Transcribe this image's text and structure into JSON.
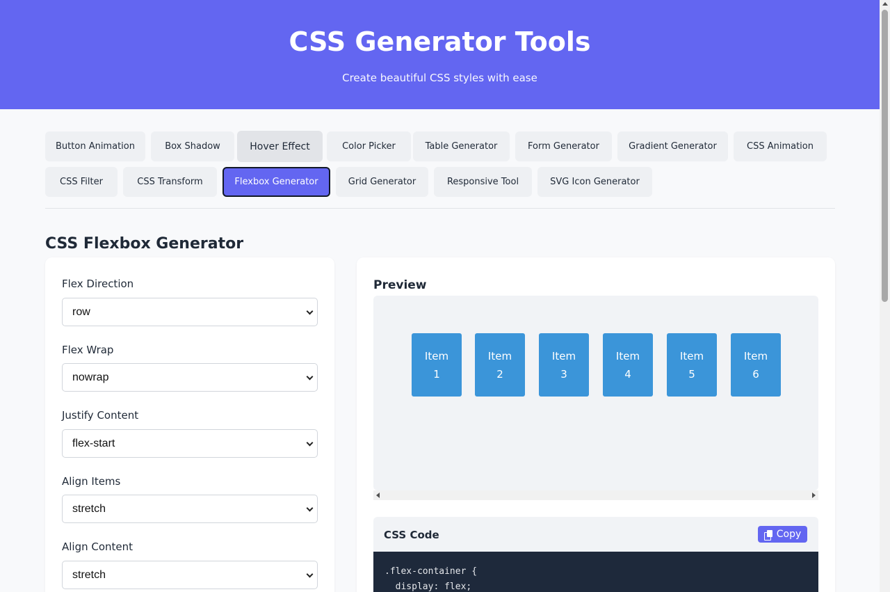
{
  "header": {
    "title": "CSS Generator Tools",
    "subtitle": "Create beautiful CSS styles with ease"
  },
  "tabs": [
    {
      "label": "Button Animation"
    },
    {
      "label": "Box Shadow"
    },
    {
      "label": "Hover Effect",
      "state": "hover"
    },
    {
      "label": "Color Picker"
    },
    {
      "label": "Table Generator"
    },
    {
      "label": "Form Generator"
    },
    {
      "label": "Gradient Generator"
    },
    {
      "label": "CSS Animation"
    },
    {
      "label": "CSS Filter"
    },
    {
      "label": "CSS Transform"
    },
    {
      "label": "Flexbox Generator",
      "state": "active"
    },
    {
      "label": "Grid Generator"
    },
    {
      "label": "Responsive Tool"
    },
    {
      "label": "SVG Icon Generator"
    }
  ],
  "section_title": "CSS Flexbox Generator",
  "controls": [
    {
      "label": "Flex Direction",
      "value": "row"
    },
    {
      "label": "Flex Wrap",
      "value": "nowrap"
    },
    {
      "label": "Justify Content",
      "value": "flex-start"
    },
    {
      "label": "Align Items",
      "value": "stretch"
    },
    {
      "label": "Align Content",
      "value": "stretch"
    }
  ],
  "preview": {
    "title": "Preview",
    "items": [
      {
        "line1": "Item",
        "line2": "1"
      },
      {
        "line1": "Item",
        "line2": "2"
      },
      {
        "line1": "Item",
        "line2": "3"
      },
      {
        "line1": "Item",
        "line2": "4"
      },
      {
        "line1": "Item",
        "line2": "5"
      },
      {
        "line1": "Item",
        "line2": "6"
      }
    ]
  },
  "code": {
    "title": "CSS Code",
    "copy_label": "Copy",
    "lines": [
      ".flex-container {",
      "  display: flex;"
    ]
  },
  "colors": {
    "accent": "#6366f1",
    "item": "#3b95d9",
    "code_bg": "#1e293b"
  }
}
